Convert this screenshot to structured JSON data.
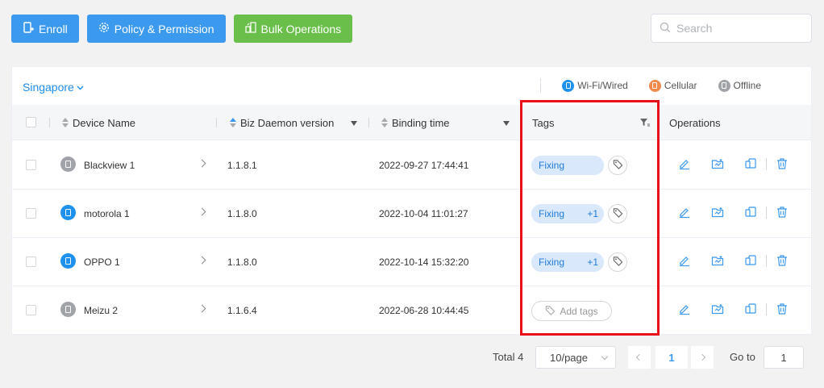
{
  "toolbar": {
    "enroll_label": "Enroll",
    "policy_label": "Policy & Permission",
    "bulk_label": "Bulk Operations",
    "search_placeholder": "Search"
  },
  "filter": {
    "region": "Singapore",
    "legend": [
      {
        "label": "Wi-Fi/Wired",
        "color": "#1e90ee"
      },
      {
        "label": "Cellular",
        "color": "#ef8a4c"
      },
      {
        "label": "Offline",
        "color": "#a0a3a8"
      }
    ]
  },
  "table": {
    "columns": {
      "device_name": "Device Name",
      "biz_daemon": "Biz Daemon version",
      "binding_time": "Binding time",
      "tags": "Tags",
      "operations": "Operations"
    },
    "rows": [
      {
        "name": "Blackview 1",
        "status": "offline",
        "status_color": "#a0a3a8",
        "version": "1.1.8.1",
        "time": "2022-09-27 17:44:41",
        "tag": "Fixing",
        "tag_more": ""
      },
      {
        "name": "motorola 1",
        "status": "wifi",
        "status_color": "#1e90ee",
        "version": "1.1.8.0",
        "time": "2022-10-04 11:01:27",
        "tag": "Fixing",
        "tag_more": "+1"
      },
      {
        "name": "OPPO 1",
        "status": "wifi",
        "status_color": "#1e90ee",
        "version": "1.1.8.0",
        "time": "2022-10-14 15:32:20",
        "tag": "Fixing",
        "tag_more": "+1"
      },
      {
        "name": "Meizu 2",
        "status": "offline",
        "status_color": "#a0a3a8",
        "version": "1.1.6.4",
        "time": "2022-06-28 10:44:45",
        "tag": "",
        "tag_more": "",
        "add_tags_label": "Add tags"
      }
    ]
  },
  "pagination": {
    "total": "Total 4",
    "page_size": "10/page",
    "current_page": "1",
    "goto_label": "Go to",
    "goto_value": "1"
  },
  "colors": {
    "primary": "#3b99ee",
    "success": "#6abf4b",
    "highlight": "#e8101b"
  }
}
